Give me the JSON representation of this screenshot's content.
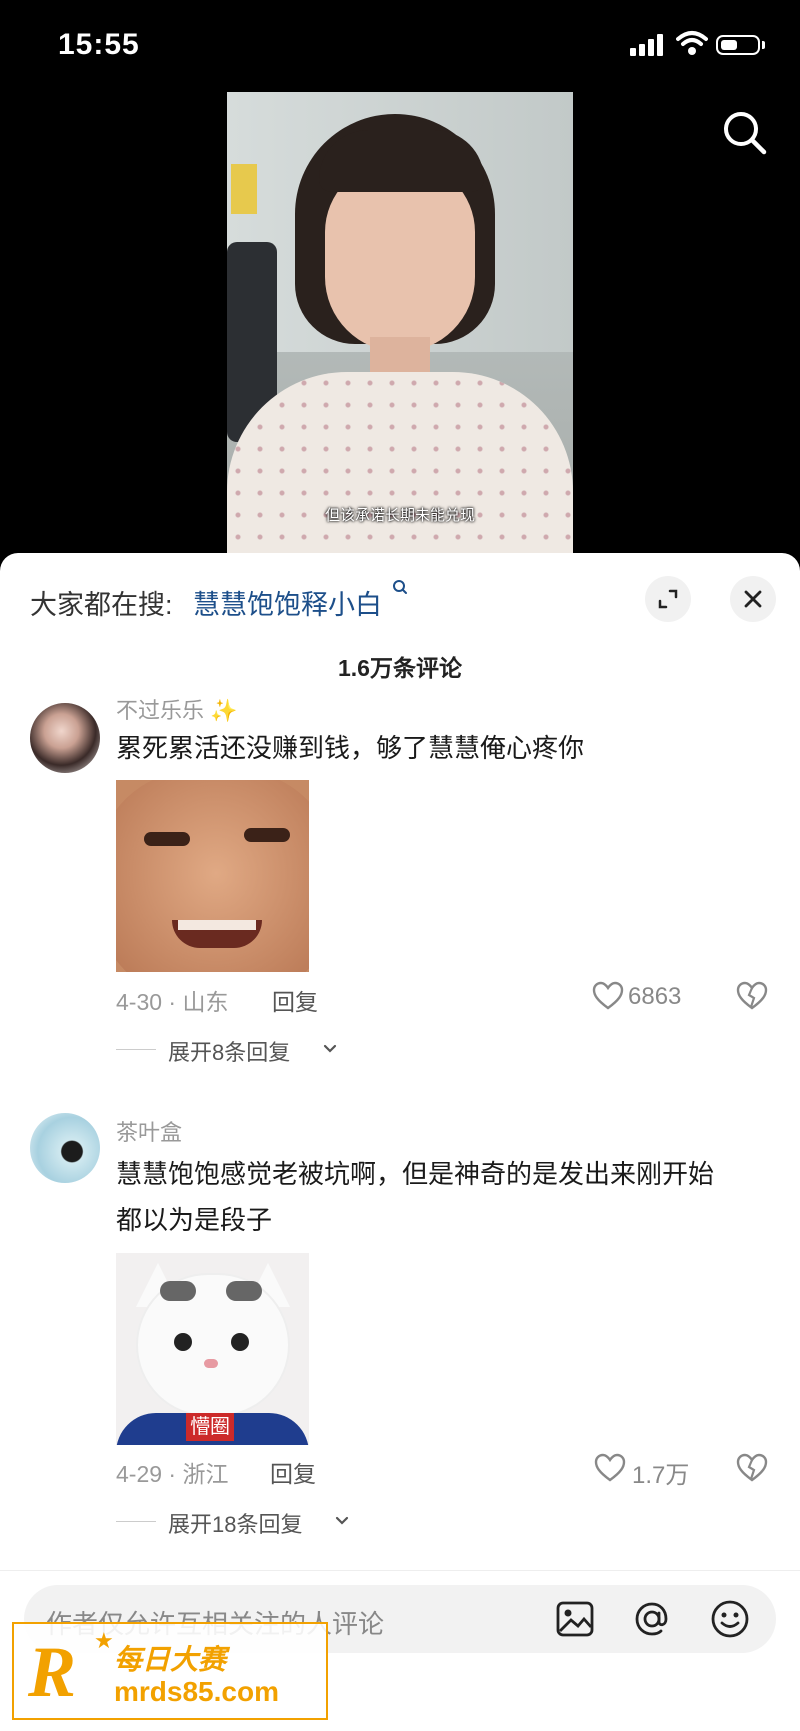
{
  "status_bar": {
    "time": "15:55"
  },
  "video": {
    "subtitle": "但该承诺长期未能兑现"
  },
  "sheet": {
    "search_prefix": "大家都在搜:",
    "search_term": "慧慧饱饱释小白",
    "comment_count": "1.6万条评论"
  },
  "comments": [
    {
      "username": "不过乐乐 ✨",
      "text": "累死累活还没赚到钱，够了慧慧俺心疼你",
      "meta": "4-30 · 山东",
      "reply_label": "回复",
      "likes": "6863",
      "expand_label": "展开8条回复"
    },
    {
      "username": "茶叶盒",
      "text_line1": "慧慧饱饱感觉老被坑啊，但是神奇的是发出来刚开始",
      "text_line2": "都以为是段子",
      "meta": "4-29 · 浙江",
      "reply_label": "回复",
      "likes": "1.7万",
      "expand_label": "展开18条回复",
      "image_tag": "懵圈"
    }
  ],
  "composer": {
    "placeholder": "作者仅允许互相关注的人评论"
  },
  "watermark": {
    "logo": "R",
    "name": "每日大赛",
    "domain": "mrds85.com"
  },
  "icons": [
    "search-icon",
    "expand-icon",
    "close-icon",
    "heart-icon",
    "dislike-icon",
    "image-icon",
    "at-icon",
    "emoji-icon",
    "chevron-down-icon"
  ]
}
